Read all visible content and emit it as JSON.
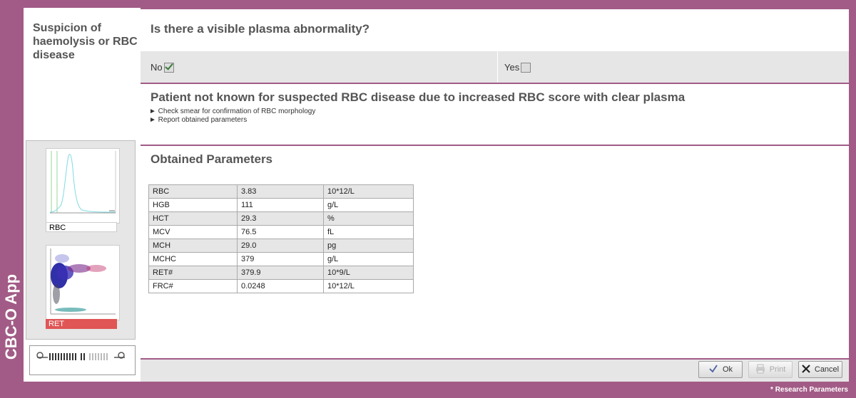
{
  "app": {
    "name": "CBC-O App"
  },
  "sidebar": {
    "title": "Suspicion of haemolysis or RBC disease",
    "thumbnails": [
      {
        "label": "RBC",
        "highlighted": false
      },
      {
        "label": "RET",
        "highlighted": true
      }
    ]
  },
  "question": {
    "text": "Is there a visible plasma abnormality?",
    "options": [
      {
        "label": "No",
        "checked": true
      },
      {
        "label": "Yes",
        "checked": false
      }
    ]
  },
  "result": {
    "title": "Patient not known for suspected RBC disease due to increased RBC score with clear plasma",
    "actions": [
      "► Check smear for confirmation of RBC morphology",
      "► Report obtained parameters"
    ]
  },
  "parameters": {
    "title": "Obtained Parameters",
    "rows": [
      {
        "name": "RBC",
        "value": "3.83",
        "unit": "10*12/L"
      },
      {
        "name": "HGB",
        "value": "111",
        "unit": "g/L"
      },
      {
        "name": "HCT",
        "value": "29.3",
        "unit": "%"
      },
      {
        "name": "MCV",
        "value": "76.5",
        "unit": "fL"
      },
      {
        "name": "MCH",
        "value": "29.0",
        "unit": "pg"
      },
      {
        "name": "MCHC",
        "value": "379",
        "unit": "g/L"
      },
      {
        "name": "RET#",
        "value": "379.9",
        "unit": "10*9/L"
      },
      {
        "name": "FRC#",
        "value": "0.0248",
        "unit": "10*12/L"
      }
    ]
  },
  "buttons": {
    "ok": "Ok",
    "print": "Print",
    "cancel": "Cancel"
  },
  "footer_note": "* Research Parameters",
  "colors": {
    "accent": "#a25b86",
    "ret_label": "#e05555",
    "panel_gray": "#e6e6e6"
  }
}
